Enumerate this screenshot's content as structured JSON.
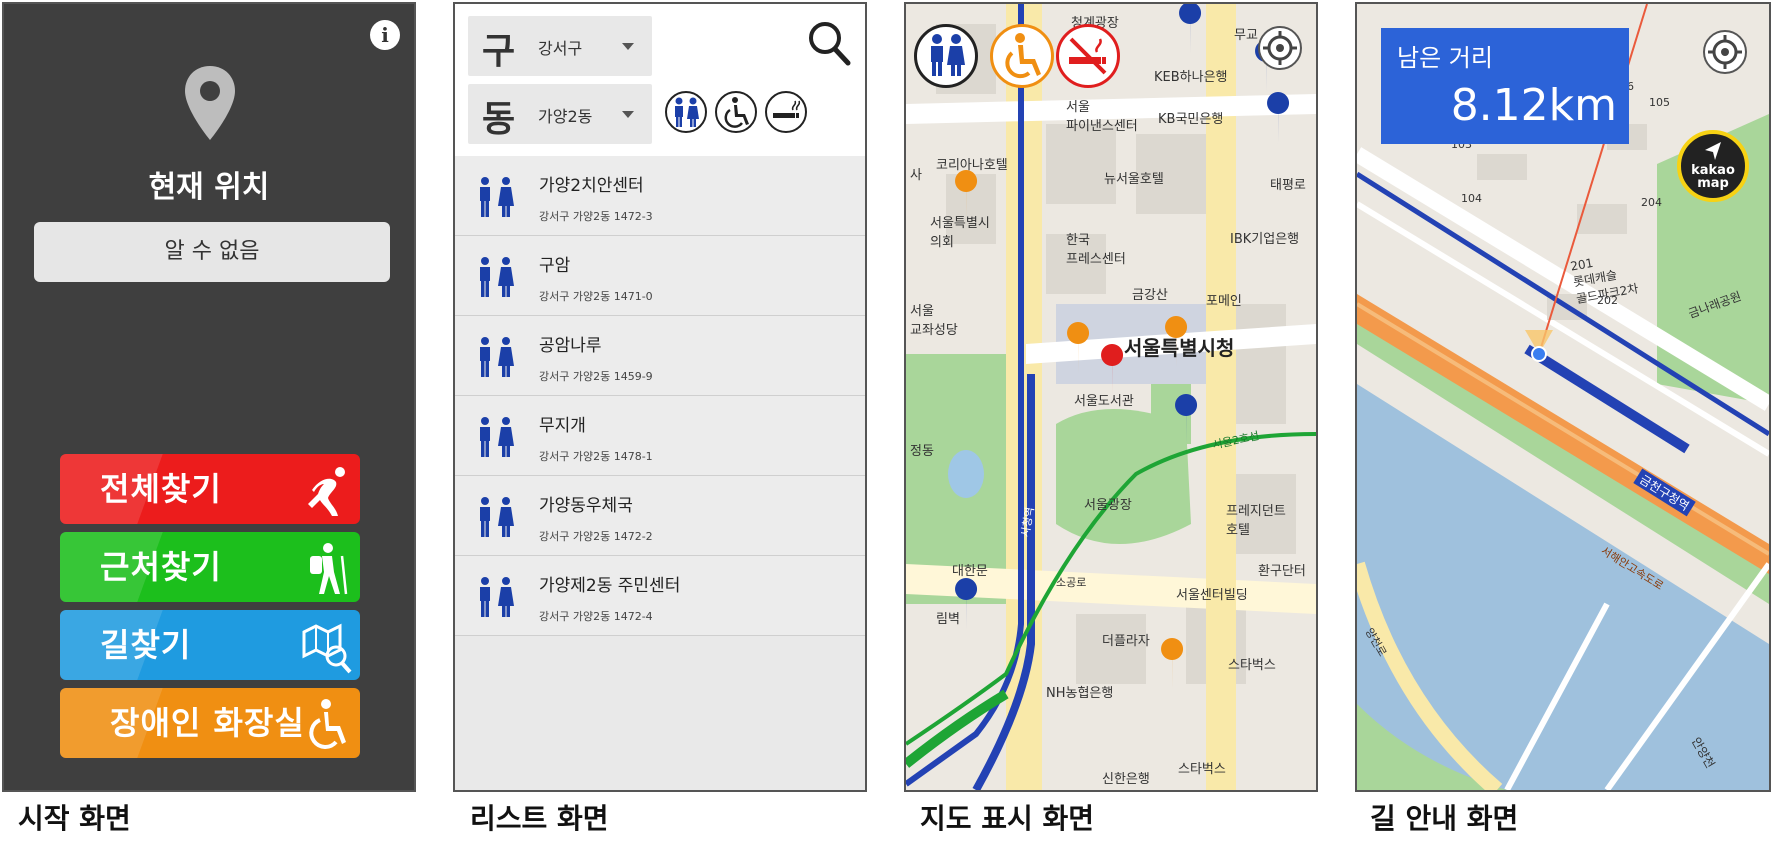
{
  "captions": {
    "start": "시작 화면",
    "list": "리스트 화면",
    "map": "지도 표시 화면",
    "nav": "길 안내 화면"
  },
  "start": {
    "title": "현재 위치",
    "location_value": "알 수 없음",
    "buttons": {
      "all": "전체찾기",
      "near": "근처찾기",
      "route": "길찾기",
      "disabled": "장애인 화장실"
    }
  },
  "list": {
    "gu_label": "구",
    "gu_value": "강서구",
    "dong_label": "동",
    "dong_value": "가양2동",
    "items": [
      {
        "name": "가양2치안센터",
        "address": "강서구 가양2동 1472-3"
      },
      {
        "name": "구암",
        "address": "강서구 가양2동 1471-0"
      },
      {
        "name": "공암나루",
        "address": "강서구 가양2동 1459-9"
      },
      {
        "name": "무지개",
        "address": "강서구 가양2동 1478-1"
      },
      {
        "name": "가양동우체국",
        "address": "강서구 가양2동 1472-2"
      },
      {
        "name": "가양제2동 주민센터",
        "address": "강서구 가양2동 1472-4"
      }
    ]
  },
  "map": {
    "labels": {
      "cheonggye": "청계광장",
      "keb": "KEB하나은행",
      "seoul_finance": "서울\n파이낸스센터",
      "kb": "KB국민은행",
      "korea_hotel": "코리아나호텔",
      "new_seoul": "뉴서울호텔",
      "council": "서울특별시\n의회",
      "press": "한국\n프레스센터",
      "ibk": "IBK기업은행",
      "taepyeong": "태평로",
      "geumgang": "금강산",
      "pomein": "포메인",
      "church": "서울\n교좌성당",
      "city_hall": "서울특별시청",
      "library": "서울도서관",
      "line2": "서울2호선",
      "plaza": "서울광장",
      "prestige": "프레지던트\n호텔",
      "daehanmun": "대한문",
      "sogong": "소공로",
      "seoul_center": "서울센터빌딩",
      "hwangu": "환구단터",
      "theplaza": "더플라자",
      "starbucks1": "스타벅스",
      "nh": "NH농협은행",
      "shinhan": "신한은행",
      "starbucks2": "스타벅스",
      "station": "시청역",
      "jeong": "정동",
      "rim": "림벽",
      "muugyo": "무교",
      "sa": "사"
    },
    "icons": [
      "restroom-icon",
      "wheelchair-icon",
      "no-smoking-icon",
      "gps-target-icon"
    ]
  },
  "nav": {
    "remain_label": "남은 거리",
    "remain_value": "8.12km",
    "kakao_label": "kakao\nmap",
    "labels": {
      "lotte": "201\n롯데캐슬\n골드파크2차",
      "geumnae": "금나래공원",
      "b103": "103",
      "b104": "104",
      "b105": "105",
      "b106": "106",
      "b204": "204",
      "b202": "202",
      "station": "금천구청역",
      "road": "서해안고속도로",
      "anyang": "안양천",
      "anyang2": "양천로"
    }
  },
  "colors": {
    "start_bg": "#3f3f3f",
    "btn_all": "#ec1c1c",
    "btn_near": "#1cbf1c",
    "btn_route": "#1f9be0",
    "btn_disabled": "#f08f12",
    "restroom_blue": "#1b3fa8",
    "nav_box": "#2c63d8"
  }
}
